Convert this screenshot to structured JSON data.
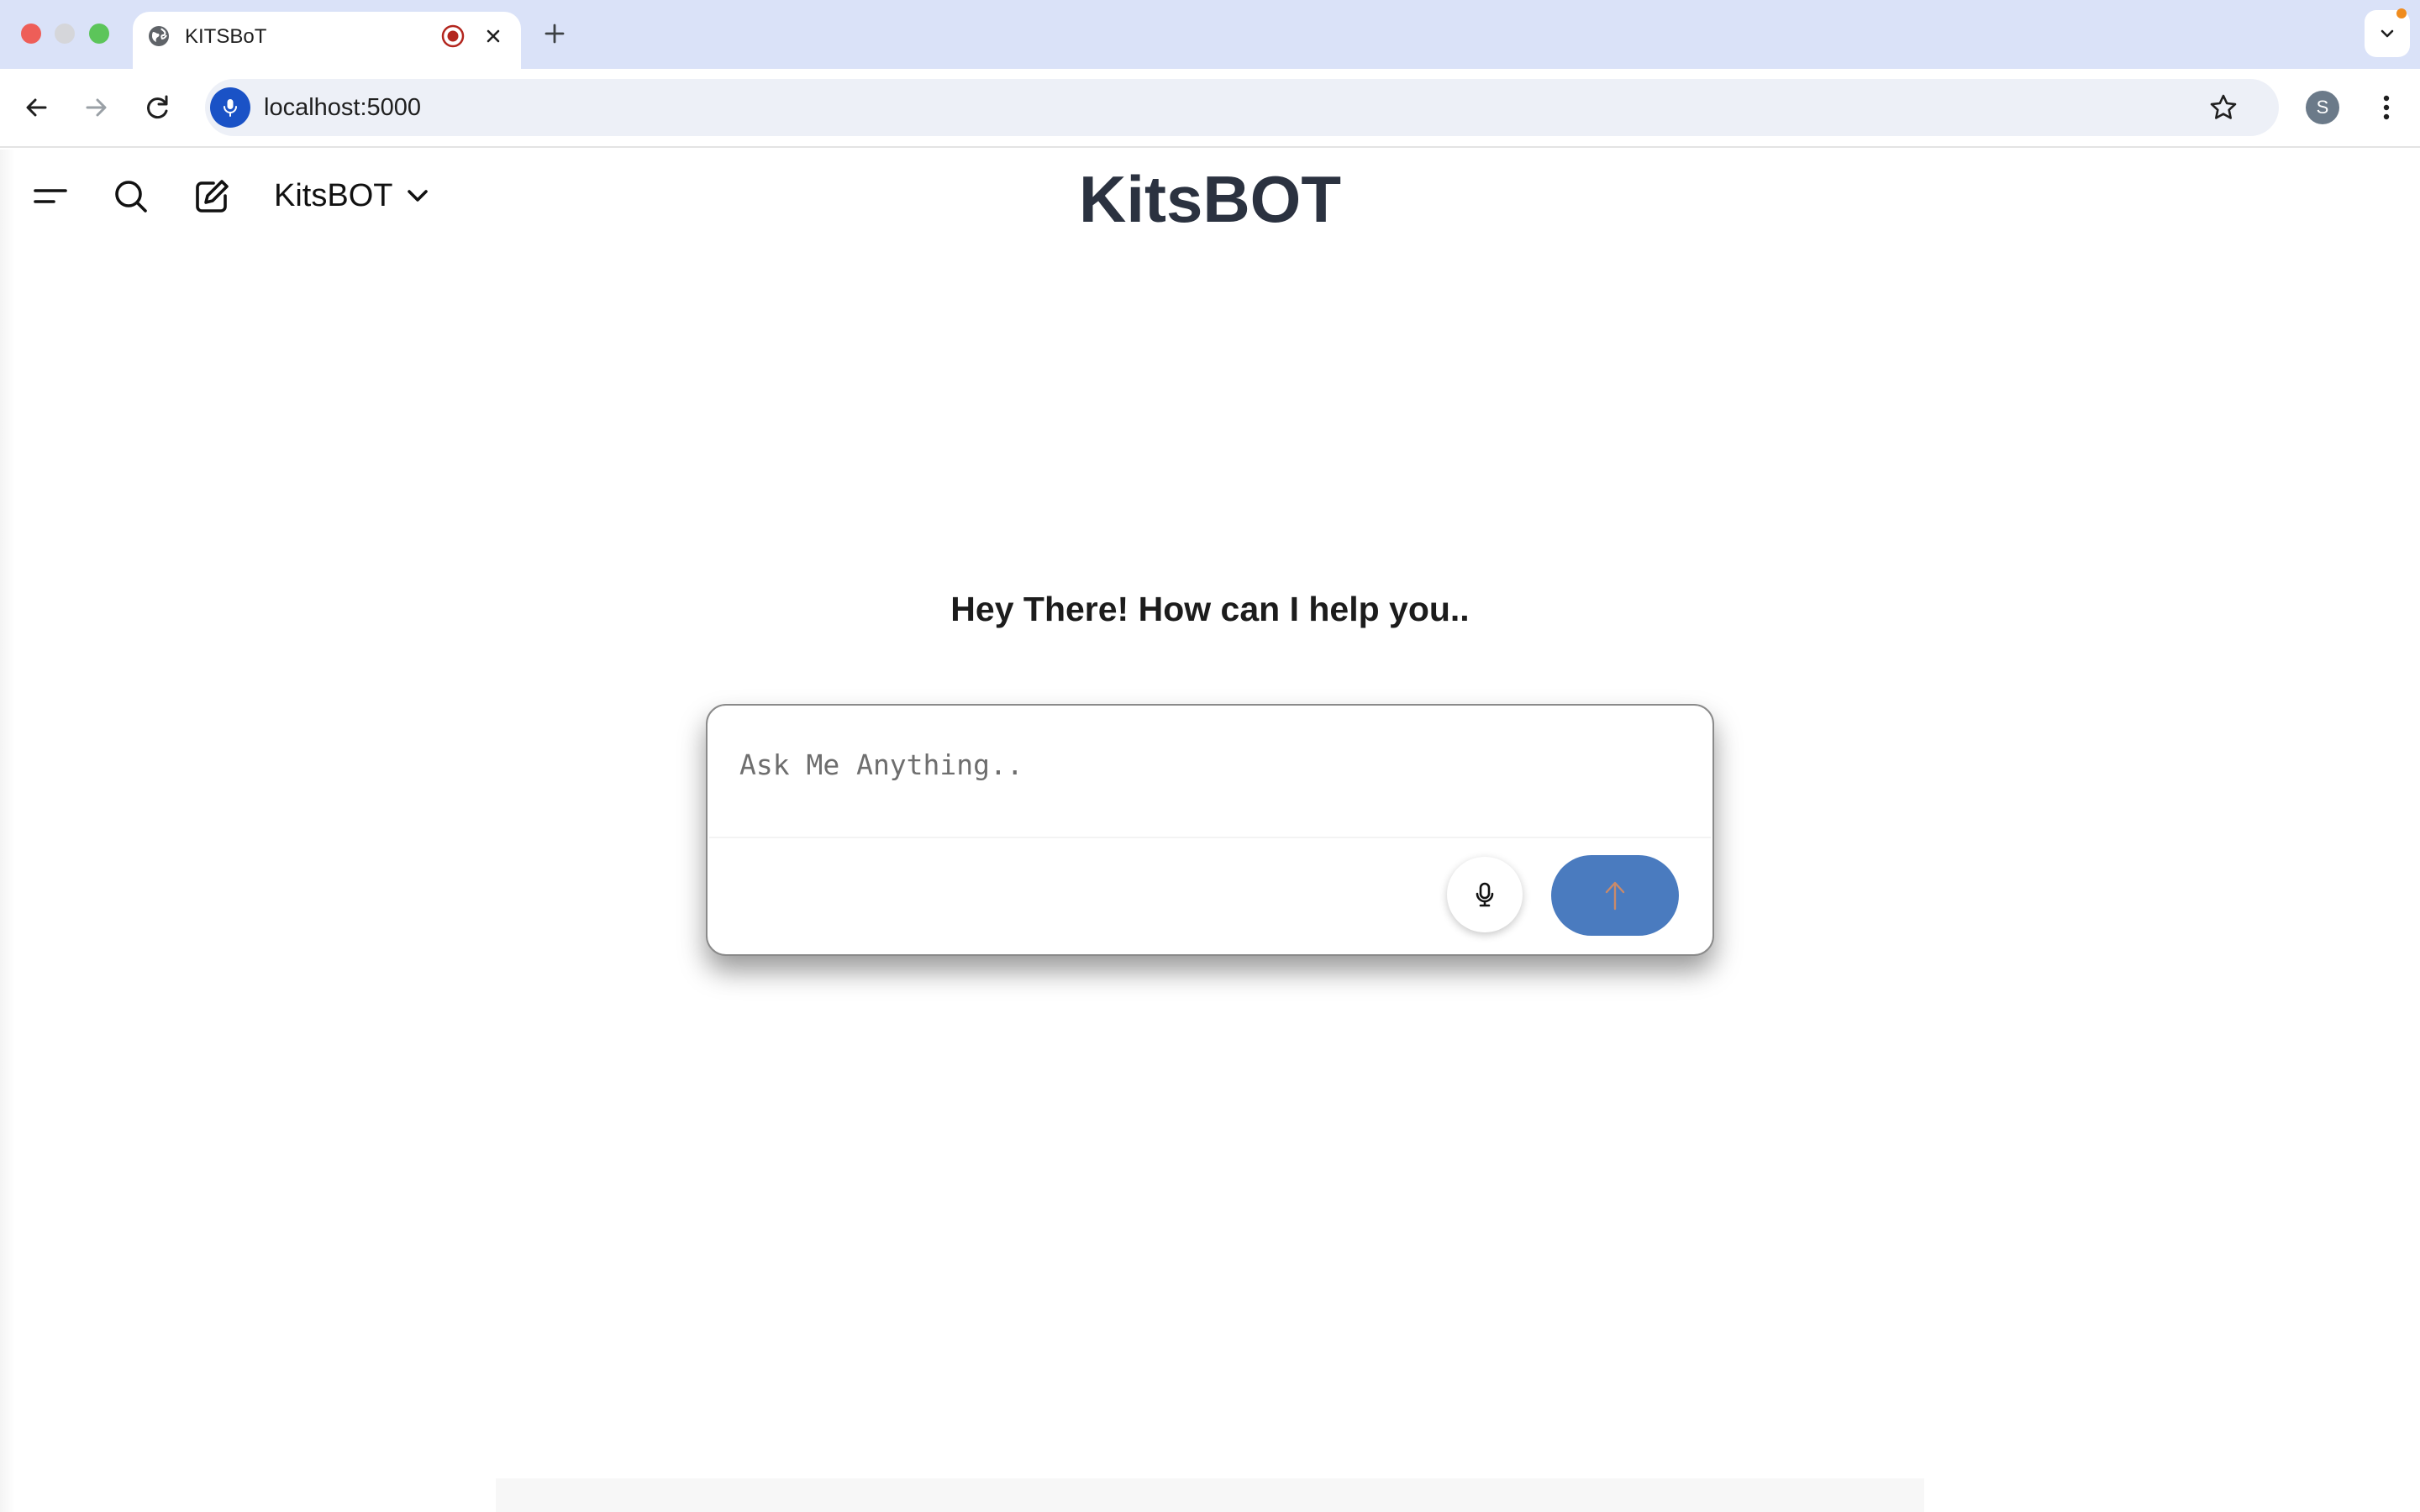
{
  "browser": {
    "tab": {
      "title": "KITSBoT",
      "favicon": "globe-icon",
      "status_icon": "recording-icon"
    },
    "address_bar": {
      "url": "localhost:5000"
    },
    "profile_initial": "S",
    "colors": {
      "tabstrip": "#dae2f8",
      "omnibox_mic": "#1a52c6",
      "recording": "#b3261e",
      "notification": "#f08c1e"
    }
  },
  "app": {
    "header": {
      "menu_icon": "menu-icon",
      "search_icon": "search-icon",
      "new_chat_icon": "edit-icon",
      "model_name": "KitsBOT",
      "title": "KitsBOT"
    },
    "greeting": "Hey There! How can I help you..",
    "composer": {
      "placeholder": "Ask Me Anything..",
      "value": "",
      "mic_icon": "microphone-icon",
      "send_icon": "arrow-up-icon"
    },
    "colors": {
      "title": "#2b3240",
      "send_button": "#4a7bbf",
      "send_arrow": "#c98a6a"
    }
  }
}
